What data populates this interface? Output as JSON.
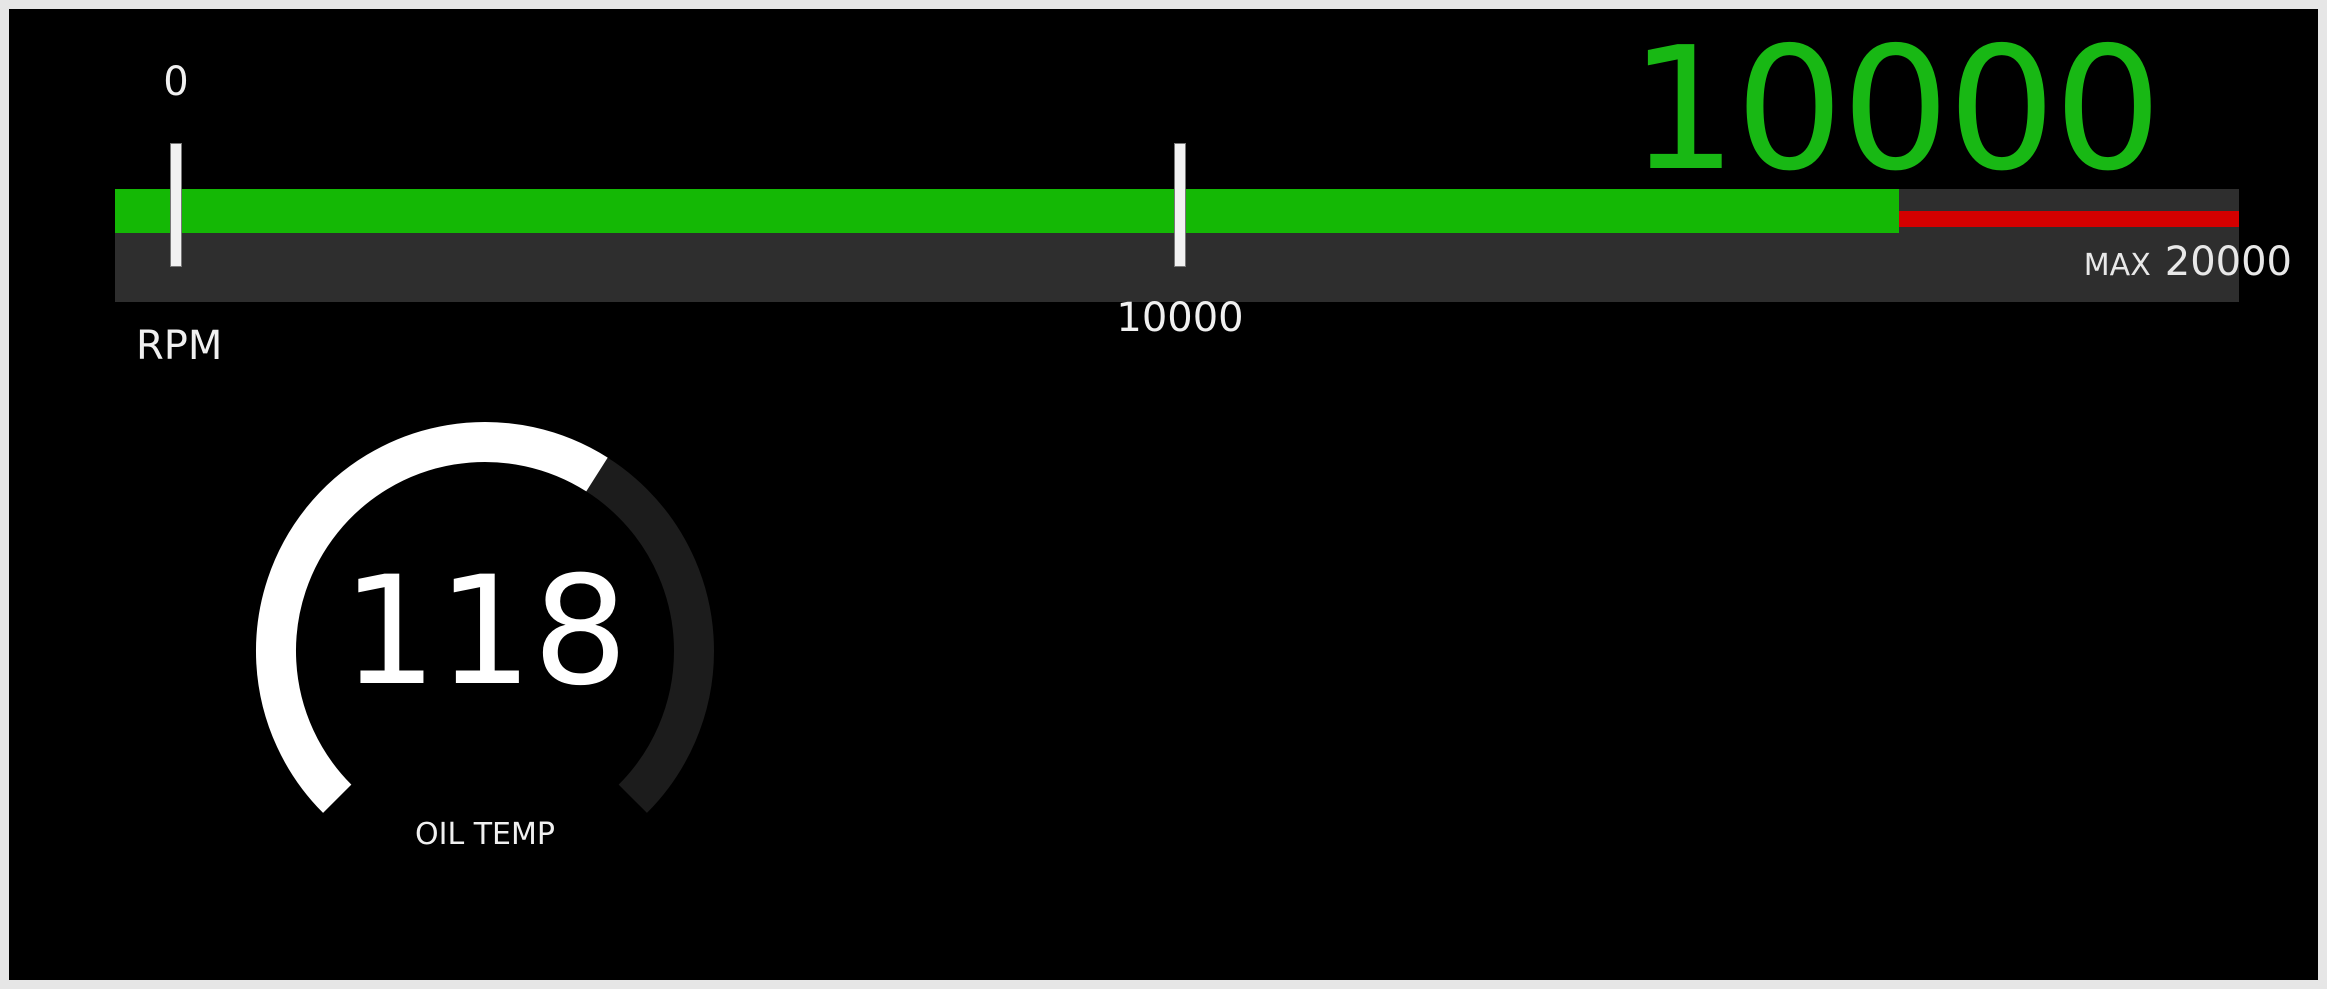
{
  "rpm": {
    "value": "10000",
    "value_number": 10000,
    "min": 0,
    "max": 20000,
    "label": "RPM",
    "max_word": "MAX",
    "max_label": "20000",
    "tick_start_label": "0",
    "tick_mid_label": "10000",
    "fill_fraction": 0.84,
    "redline_fraction": 0.84,
    "colors": {
      "fill": "#14b805",
      "redline": "#d40000",
      "track": "#2e2e2e",
      "value_text": "#18b814"
    }
  },
  "oil_temp": {
    "value": "118",
    "label": "OIL TEMP",
    "fraction": 0.62,
    "colors": {
      "arc_active": "#ffffff",
      "arc_inactive": "#1c1c1c"
    }
  }
}
